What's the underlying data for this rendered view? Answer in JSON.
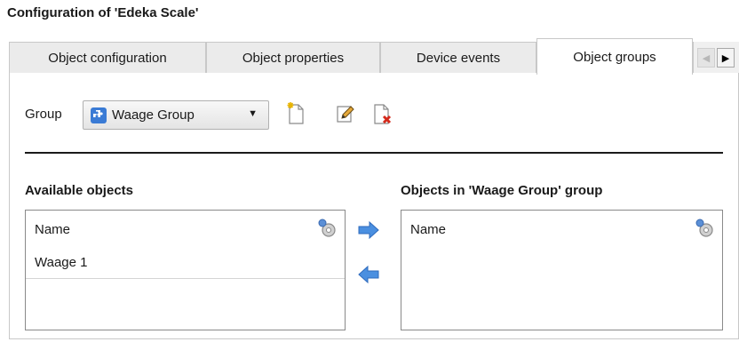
{
  "window": {
    "title": "Configuration of 'Edeka Scale'"
  },
  "tabs": [
    {
      "label": "Object configuration",
      "active": false
    },
    {
      "label": "Object properties",
      "active": false
    },
    {
      "label": "Device events",
      "active": false
    },
    {
      "label": "Object groups",
      "active": true
    }
  ],
  "group": {
    "label": "Group",
    "selected": "Waage Group",
    "actions": [
      "new-group-icon",
      "edit-group-icon",
      "delete-group-icon"
    ]
  },
  "available": {
    "title": "Available objects",
    "column": "Name",
    "items": [
      "Waage 1"
    ]
  },
  "in_group": {
    "title": "Objects in 'Waage Group' group",
    "column": "Name",
    "items": []
  },
  "colors": {
    "arrow": "#4a8fe0",
    "accent": "#3a7bd5",
    "delete": "#d42a1c"
  }
}
